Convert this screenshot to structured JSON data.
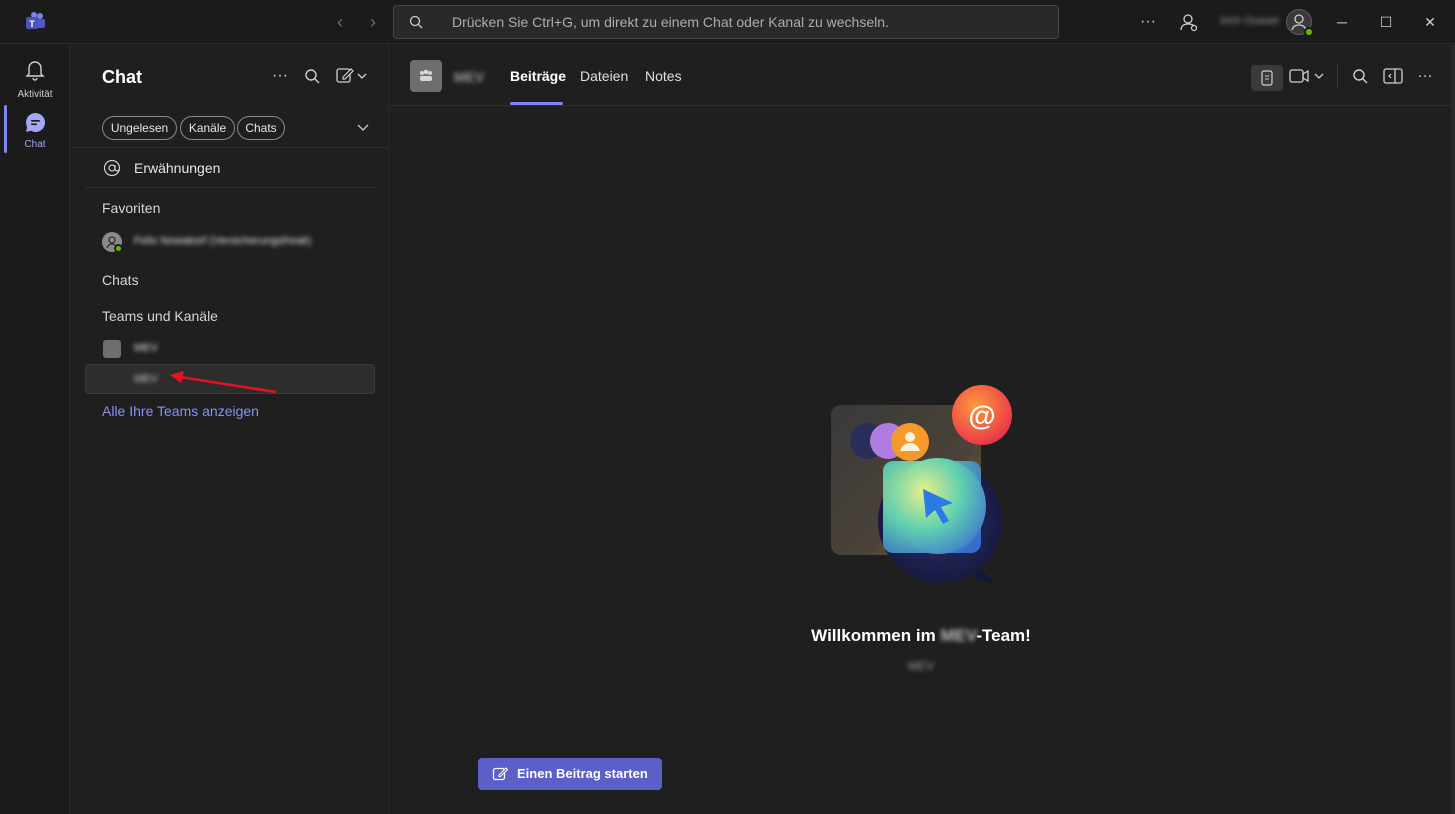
{
  "titlebar": {
    "search_placeholder": "Drücken Sie Ctrl+G, um direkt zu einem Chat oder Kanal zu wechseln.",
    "user_name": "Irich Ousset",
    "more_label": "···"
  },
  "rail": {
    "items": [
      {
        "label": "Aktivität",
        "icon": "bell-icon"
      },
      {
        "label": "Chat",
        "icon": "chat-icon",
        "active": true
      }
    ]
  },
  "pane": {
    "title": "Chat",
    "filters": [
      "Ungelesen",
      "Kanäle",
      "Chats"
    ],
    "mentions_label": "Erwähnungen",
    "favorites_header": "Favoriten",
    "favorite_item": "Felix Nowakorf (Versicherungsfreak)",
    "chats_header": "Chats",
    "teams_header": "Teams und Kanäle",
    "team_name": "MEV",
    "channel_name": "MEV",
    "all_teams_link": "Alle Ihre Teams anzeigen"
  },
  "main": {
    "team_name": "MEV",
    "tabs": [
      "Beiträge",
      "Dateien",
      "Notes"
    ],
    "active_tab": "Beiträge",
    "welcome_prefix": "Willkommen im ",
    "welcome_team": "MEV",
    "welcome_suffix": "-Team!",
    "welcome_sub": "MEV",
    "start_post_button": "Einen Beitrag starten"
  },
  "colors": {
    "accent": "#5b5fc7",
    "accent_light": "#7f85f5",
    "link": "#8b90f5",
    "presence_available": "#6bb700",
    "annotation_arrow": "#e81123"
  }
}
